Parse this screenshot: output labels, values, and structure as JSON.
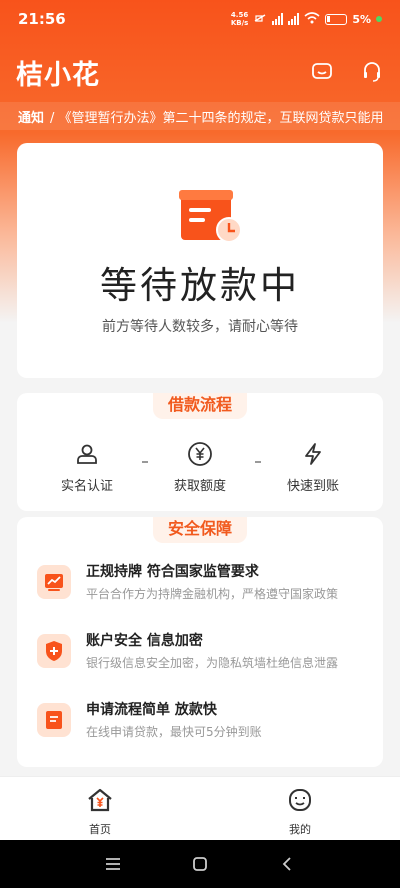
{
  "status_bar": {
    "time": "21:56",
    "net_speed": "4.56\nKB/s",
    "battery": "5%"
  },
  "header": {
    "logo": "桔小花",
    "icons": [
      "message-icon",
      "headset-icon"
    ]
  },
  "notice": {
    "label": "通知",
    "text": "/ 《管理暂行办法》第二十四条的规定，互联网贷款只能用"
  },
  "main_card": {
    "title": "等待放款中",
    "subtitle": "前方等待人数较多，请耐心等待"
  },
  "flow": {
    "title": "借款流程",
    "steps": [
      {
        "label": "实名认证",
        "icon": "person-icon"
      },
      {
        "label": "获取额度",
        "icon": "yen-icon"
      },
      {
        "label": "快速到账",
        "icon": "lightning-icon"
      }
    ]
  },
  "safety": {
    "title": "安全保障",
    "items": [
      {
        "title": "正规持牌  符合国家监管要求",
        "desc": "平台合作方为持牌金融机构，严格遵守国家政策",
        "icon": "chart-icon"
      },
      {
        "title": "账户安全  信息加密",
        "desc": "银行级信息安全加密，为隐私筑墙杜绝信息泄露",
        "icon": "shield-icon"
      },
      {
        "title": "申请流程简单  放款快",
        "desc": "在线申请贷款，最快可5分钟到账",
        "icon": "document-icon"
      }
    ]
  },
  "tabbar": {
    "tabs": [
      {
        "label": "首页",
        "icon": "home-icon"
      },
      {
        "label": "我的",
        "icon": "profile-icon"
      }
    ]
  },
  "colors": {
    "brand": "#f8531b",
    "accent_text": "#f15a1e"
  }
}
